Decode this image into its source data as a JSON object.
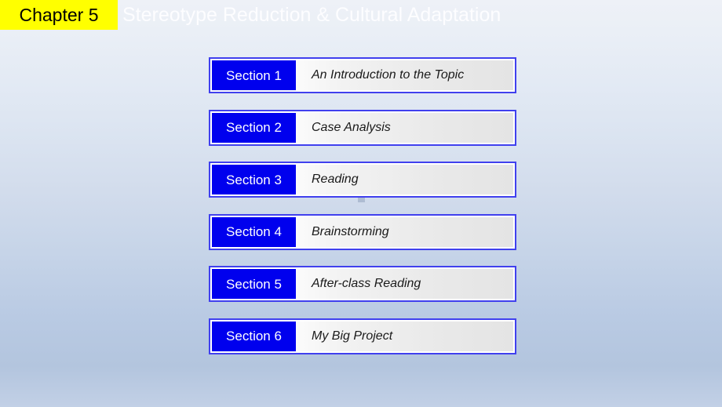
{
  "slide": {
    "chapter_badge": "Chapter 5",
    "title": "Stereotype Reduction & Cultural Adaptation",
    "colors": {
      "badge_background": "#ffff00",
      "badge_text": "#000000",
      "title_text": "#fdfdff",
      "tag_background": "#0000ee",
      "tag_text": "#ffffff",
      "row_border": "#4040ee",
      "body_text": "#1a1a1a",
      "background_top": "#eef1f7",
      "background_bottom": "#b3c5de"
    }
  },
  "sections": [
    {
      "tag": "Section 1",
      "title": "An Introduction to the Topic"
    },
    {
      "tag": "Section 2",
      "title": "Case Analysis"
    },
    {
      "tag": "Section 3",
      "title": "Reading"
    },
    {
      "tag": "Section 4",
      "title": "Brainstorming"
    },
    {
      "tag": "Section 5",
      "title": "After-class Reading"
    },
    {
      "tag": "Section 6",
      "title": "My Big Project"
    }
  ]
}
